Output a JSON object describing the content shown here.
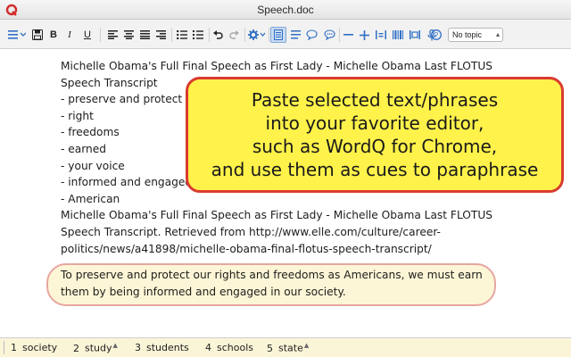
{
  "window": {
    "title": "Speech.doc"
  },
  "toolbar": {
    "bold_label": "B",
    "italic_label": "I",
    "underline_label": "U",
    "topic_select": {
      "value": "No topic"
    }
  },
  "document": {
    "lines": [
      "Michelle Obama's Full Final Speech as First Lady - Michelle Obama Last FLOTUS",
      "Speech Transcript",
      "- preserve and protect",
      "- right",
      "- freedoms",
      "- earned",
      "- your voice",
      "- informed and engaged",
      "- American",
      "Michelle Obama's Full Final Speech as First Lady - Michelle Obama Last FLOTUS",
      "Speech Transcript. Retrieved from http://www.elle.com/culture/career-",
      "politics/news/a41898/michelle-obama-final-flotus-speech-transcript/"
    ],
    "highlighted_lines": [
      "To preserve and protect our rights and freedoms as Americans, we must earn",
      "them by being informed and engaged in our society."
    ]
  },
  "callout": {
    "lines": [
      "Paste selected text/phrases",
      "into your favorite editor,",
      "such as WordQ for Chrome,",
      "and use them as cues to paraphrase"
    ]
  },
  "predictions": [
    {
      "number": "1",
      "word": "society",
      "marked": false
    },
    {
      "number": "2",
      "word": "study",
      "marked": true
    },
    {
      "number": "3",
      "word": "students",
      "marked": false
    },
    {
      "number": "4",
      "word": "schools",
      "marked": false
    },
    {
      "number": "5",
      "word": "state",
      "marked": true
    }
  ],
  "colors": {
    "callout_fill": "#fff24a",
    "callout_border": "#d93b30",
    "highlight_fill": "#fdf6d6",
    "highlight_border": "#e7a6a0",
    "prediction_bar": "#fbf5d8",
    "toolbar_blue": "#2f6fc4"
  },
  "icons": {
    "app": "wordq-logo-icon",
    "toolbar": [
      "menu-icon",
      "save-icon",
      "bold-icon",
      "italic-icon",
      "underline-icon",
      "align-left-icon",
      "align-center-icon",
      "align-justify-icon",
      "bullet-list-icon",
      "numbered-list-icon",
      "undo-icon",
      "redo-icon",
      "settings-icon",
      "document-view-icon",
      "align-lines-icon",
      "speech-bubble-icon",
      "chat-bubble-icon",
      "minus-icon",
      "plus-icon",
      "bar-spacing-icon",
      "barcode-icon",
      "columns-icon",
      "microphone-icon",
      "help-icon"
    ]
  }
}
